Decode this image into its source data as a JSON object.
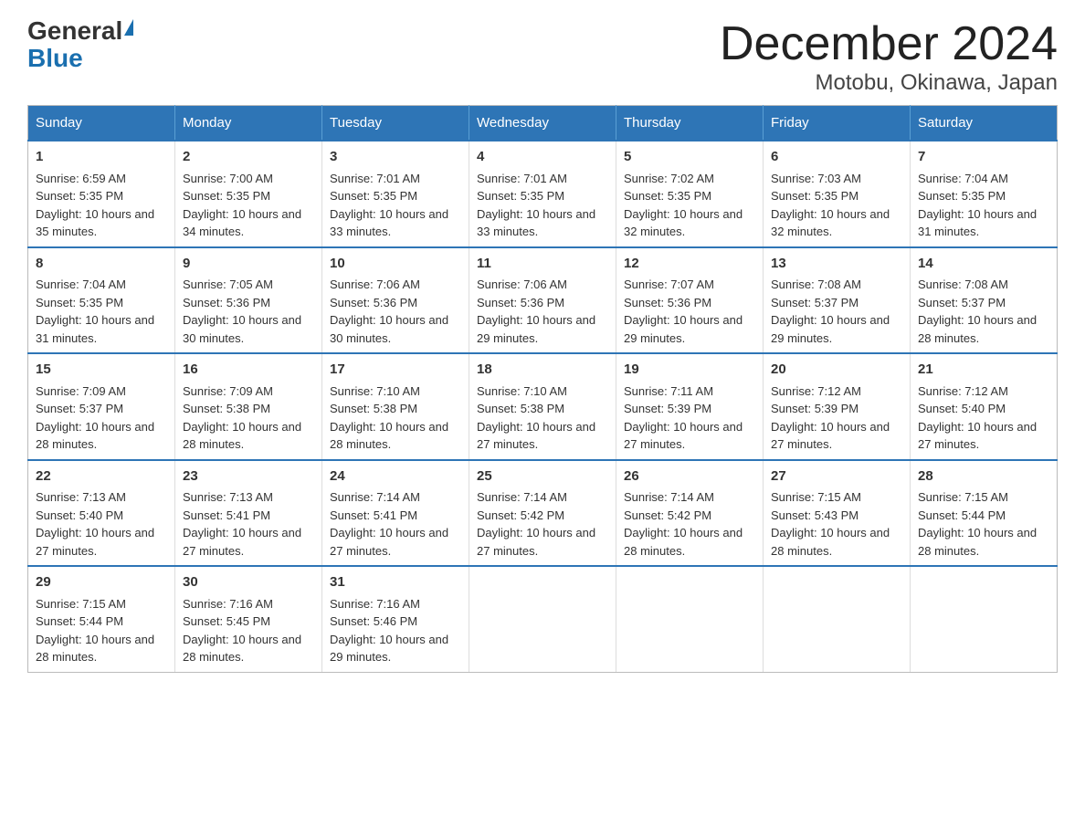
{
  "logo": {
    "general": "General",
    "blue": "Blue"
  },
  "title": "December 2024",
  "subtitle": "Motobu, Okinawa, Japan",
  "headers": [
    "Sunday",
    "Monday",
    "Tuesday",
    "Wednesday",
    "Thursday",
    "Friday",
    "Saturday"
  ],
  "weeks": [
    [
      {
        "day": "1",
        "sunrise": "6:59 AM",
        "sunset": "5:35 PM",
        "daylight": "10 hours and 35 minutes."
      },
      {
        "day": "2",
        "sunrise": "7:00 AM",
        "sunset": "5:35 PM",
        "daylight": "10 hours and 34 minutes."
      },
      {
        "day": "3",
        "sunrise": "7:01 AM",
        "sunset": "5:35 PM",
        "daylight": "10 hours and 33 minutes."
      },
      {
        "day": "4",
        "sunrise": "7:01 AM",
        "sunset": "5:35 PM",
        "daylight": "10 hours and 33 minutes."
      },
      {
        "day": "5",
        "sunrise": "7:02 AM",
        "sunset": "5:35 PM",
        "daylight": "10 hours and 32 minutes."
      },
      {
        "day": "6",
        "sunrise": "7:03 AM",
        "sunset": "5:35 PM",
        "daylight": "10 hours and 32 minutes."
      },
      {
        "day": "7",
        "sunrise": "7:04 AM",
        "sunset": "5:35 PM",
        "daylight": "10 hours and 31 minutes."
      }
    ],
    [
      {
        "day": "8",
        "sunrise": "7:04 AM",
        "sunset": "5:35 PM",
        "daylight": "10 hours and 31 minutes."
      },
      {
        "day": "9",
        "sunrise": "7:05 AM",
        "sunset": "5:36 PM",
        "daylight": "10 hours and 30 minutes."
      },
      {
        "day": "10",
        "sunrise": "7:06 AM",
        "sunset": "5:36 PM",
        "daylight": "10 hours and 30 minutes."
      },
      {
        "day": "11",
        "sunrise": "7:06 AM",
        "sunset": "5:36 PM",
        "daylight": "10 hours and 29 minutes."
      },
      {
        "day": "12",
        "sunrise": "7:07 AM",
        "sunset": "5:36 PM",
        "daylight": "10 hours and 29 minutes."
      },
      {
        "day": "13",
        "sunrise": "7:08 AM",
        "sunset": "5:37 PM",
        "daylight": "10 hours and 29 minutes."
      },
      {
        "day": "14",
        "sunrise": "7:08 AM",
        "sunset": "5:37 PM",
        "daylight": "10 hours and 28 minutes."
      }
    ],
    [
      {
        "day": "15",
        "sunrise": "7:09 AM",
        "sunset": "5:37 PM",
        "daylight": "10 hours and 28 minutes."
      },
      {
        "day": "16",
        "sunrise": "7:09 AM",
        "sunset": "5:38 PM",
        "daylight": "10 hours and 28 minutes."
      },
      {
        "day": "17",
        "sunrise": "7:10 AM",
        "sunset": "5:38 PM",
        "daylight": "10 hours and 28 minutes."
      },
      {
        "day": "18",
        "sunrise": "7:10 AM",
        "sunset": "5:38 PM",
        "daylight": "10 hours and 27 minutes."
      },
      {
        "day": "19",
        "sunrise": "7:11 AM",
        "sunset": "5:39 PM",
        "daylight": "10 hours and 27 minutes."
      },
      {
        "day": "20",
        "sunrise": "7:12 AM",
        "sunset": "5:39 PM",
        "daylight": "10 hours and 27 minutes."
      },
      {
        "day": "21",
        "sunrise": "7:12 AM",
        "sunset": "5:40 PM",
        "daylight": "10 hours and 27 minutes."
      }
    ],
    [
      {
        "day": "22",
        "sunrise": "7:13 AM",
        "sunset": "5:40 PM",
        "daylight": "10 hours and 27 minutes."
      },
      {
        "day": "23",
        "sunrise": "7:13 AM",
        "sunset": "5:41 PM",
        "daylight": "10 hours and 27 minutes."
      },
      {
        "day": "24",
        "sunrise": "7:14 AM",
        "sunset": "5:41 PM",
        "daylight": "10 hours and 27 minutes."
      },
      {
        "day": "25",
        "sunrise": "7:14 AM",
        "sunset": "5:42 PM",
        "daylight": "10 hours and 27 minutes."
      },
      {
        "day": "26",
        "sunrise": "7:14 AM",
        "sunset": "5:42 PM",
        "daylight": "10 hours and 28 minutes."
      },
      {
        "day": "27",
        "sunrise": "7:15 AM",
        "sunset": "5:43 PM",
        "daylight": "10 hours and 28 minutes."
      },
      {
        "day": "28",
        "sunrise": "7:15 AM",
        "sunset": "5:44 PM",
        "daylight": "10 hours and 28 minutes."
      }
    ],
    [
      {
        "day": "29",
        "sunrise": "7:15 AM",
        "sunset": "5:44 PM",
        "daylight": "10 hours and 28 minutes."
      },
      {
        "day": "30",
        "sunrise": "7:16 AM",
        "sunset": "5:45 PM",
        "daylight": "10 hours and 28 minutes."
      },
      {
        "day": "31",
        "sunrise": "7:16 AM",
        "sunset": "5:46 PM",
        "daylight": "10 hours and 29 minutes."
      },
      null,
      null,
      null,
      null
    ]
  ],
  "labels": {
    "sunrise": "Sunrise:",
    "sunset": "Sunset:",
    "daylight": "Daylight:"
  }
}
